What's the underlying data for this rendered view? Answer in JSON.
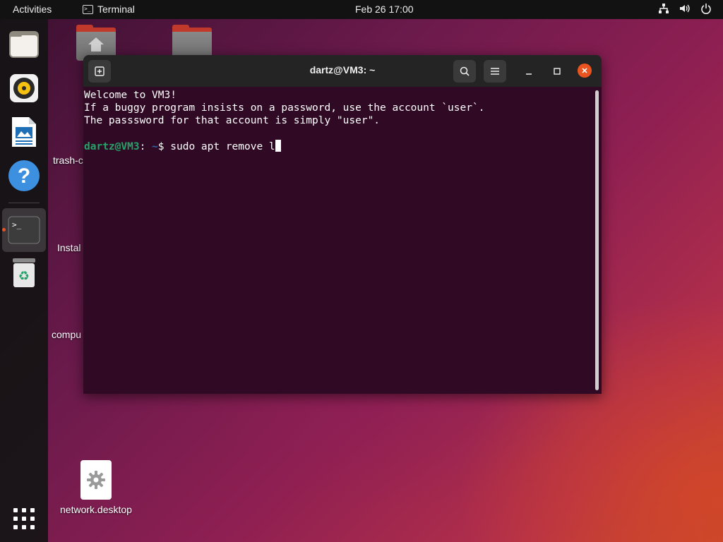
{
  "topbar": {
    "activities": "Activities",
    "app_name": "Terminal",
    "clock": "Feb 26  17:00"
  },
  "desktop": {
    "trash_label": "trash-c",
    "install_label": "Instal",
    "computer_label": "compu",
    "network_label": "network.desktop"
  },
  "terminal": {
    "title": "dartz@VM3: ~",
    "lines": [
      "Welcome to VM3!",
      "If a buggy program insists on a password, use the account `user`.",
      "The passsword for that account is simply \"user\"."
    ],
    "prompt_user": "dartz@VM3",
    "prompt_sep": ":",
    "prompt_path": " ~",
    "prompt_symbol": "$ ",
    "command": "sudo apt remove l"
  },
  "colors": {
    "terminal_bg": "#300a24",
    "accent": "#e95420",
    "prompt_user": "#26a269",
    "prompt_path": "#3465a4"
  },
  "icons": {
    "dock": [
      "files-icon",
      "rhythmbox-icon",
      "libreoffice-impress-icon",
      "help-icon",
      "terminal-icon",
      "trash-icon",
      "show-apps-icon"
    ],
    "tray": [
      "network-icon",
      "volume-icon",
      "power-icon"
    ]
  }
}
